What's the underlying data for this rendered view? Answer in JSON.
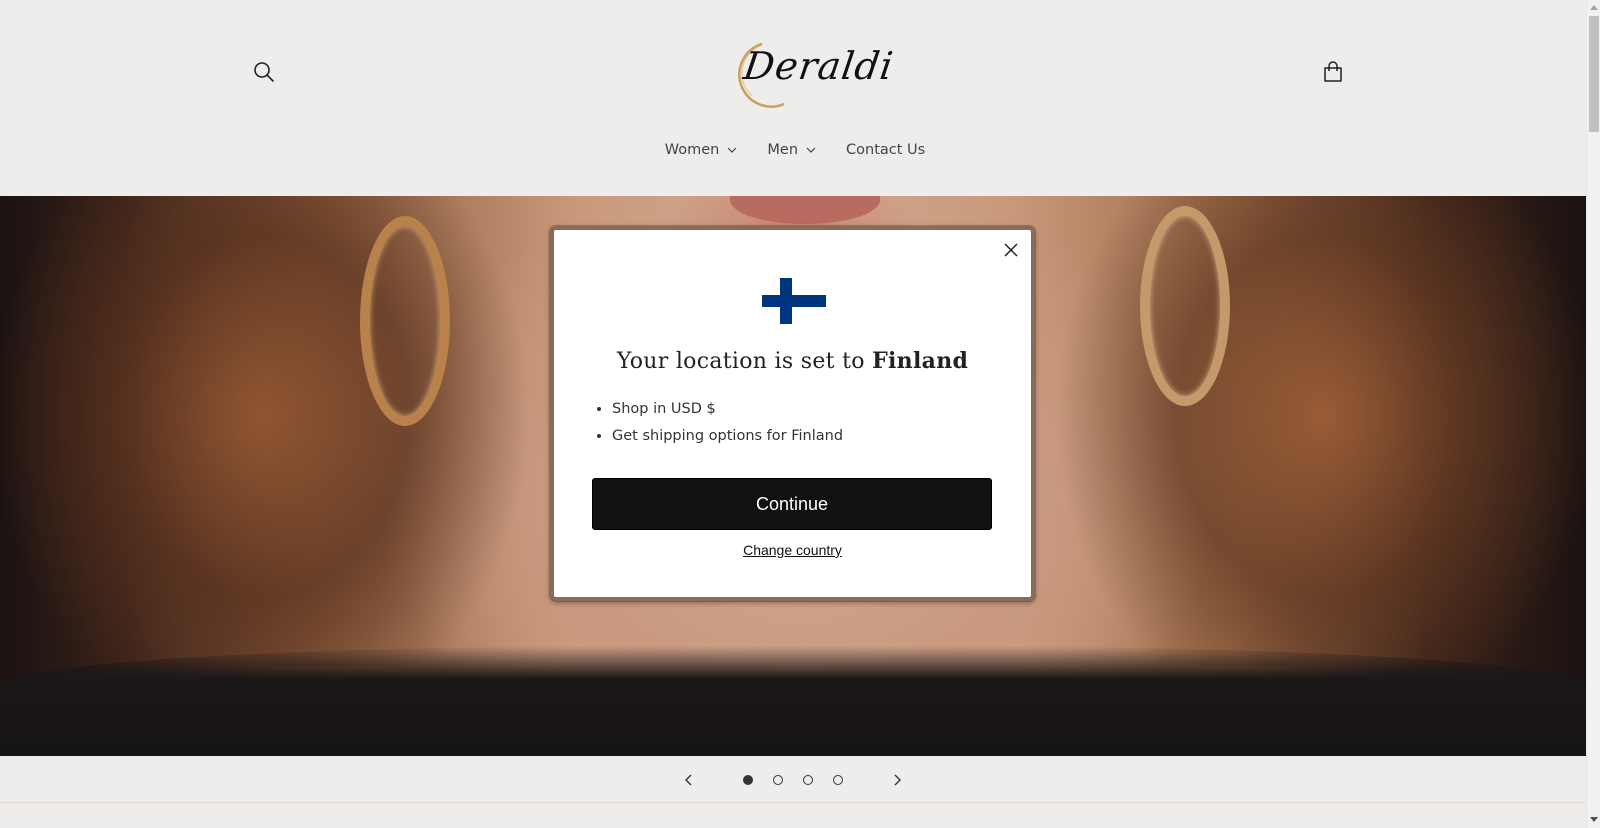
{
  "header": {
    "logo_text": "Deraldi",
    "nav": [
      {
        "label": "Women",
        "has_dropdown": true
      },
      {
        "label": "Men",
        "has_dropdown": true
      },
      {
        "label": "Contact Us",
        "has_dropdown": false
      }
    ],
    "search_icon": "search-icon",
    "cart_icon": "cart-icon"
  },
  "hero": {
    "image_subject": "close-up of woman wearing gold hoop earrings",
    "slides_total": 4,
    "active_slide": 1
  },
  "modal": {
    "flag": "finland-flag",
    "title_prefix": "Your location is set to",
    "title_country": "Finland",
    "bullets": [
      "Shop in USD $",
      "Get shipping options for Finland"
    ],
    "continue_label": "Continue",
    "change_country_label": "Change country",
    "close_icon": "close-icon"
  },
  "colors": {
    "page_bg": "#efedeb",
    "button_bg": "#111111",
    "flag_blue": "#003580",
    "modal_border": "#8a6a58"
  }
}
